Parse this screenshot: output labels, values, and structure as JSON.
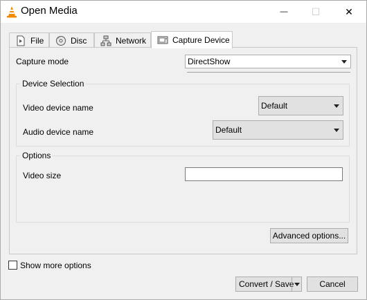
{
  "window": {
    "title": "Open Media",
    "minimize_glyph": "—",
    "maximize_glyph": "☐",
    "close_glyph": "✕"
  },
  "tabs": [
    {
      "label": "File",
      "icon": "file-icon"
    },
    {
      "label": "Disc",
      "icon": "disc-icon"
    },
    {
      "label": "Network",
      "icon": "network-icon"
    },
    {
      "label": "Capture Device",
      "icon": "capture-device-icon",
      "selected": true
    }
  ],
  "capture": {
    "mode_label": "Capture mode",
    "mode_value": "DirectShow"
  },
  "device_selection": {
    "title": "Device Selection",
    "video_label": "Video device name",
    "video_value": "Default",
    "audio_label": "Audio device name",
    "audio_value": "Default"
  },
  "options": {
    "title": "Options",
    "video_size_label": "Video size",
    "video_size_value": ""
  },
  "buttons": {
    "advanced": "Advanced options...",
    "show_more": "Show more options",
    "convert": "Convert / Save",
    "cancel": "Cancel"
  },
  "colors": {
    "vlc_orange": "#f48a00",
    "vlc_white": "#ffffff"
  }
}
